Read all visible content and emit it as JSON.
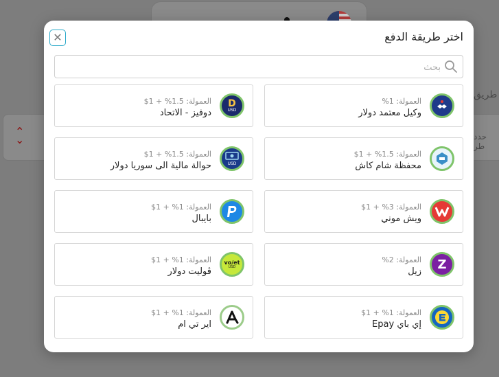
{
  "modal": {
    "title": "اختر طريقة الدفع",
    "close_label": "✕",
    "search_placeholder": "بحث"
  },
  "background": {
    "side_text_1": "طريق",
    "side_text_2": "حدد طر"
  },
  "fee_prefix": "العمولة:",
  "methods": [
    {
      "name": "وكيل معتمد دولار",
      "fee": "العمولة: 1%",
      "icon": "handshake-icon"
    },
    {
      "name": "دوفيز - الاتحاد",
      "fee": "العمولة: 1.5% + 1$",
      "icon": "dovise-icon"
    },
    {
      "name": "محفظة شام كاش",
      "fee": "العمولة: 1.5% + 1$",
      "icon": "sham-cash-icon"
    },
    {
      "name": "حوالة مالية الى سوريا دولار",
      "fee": "العمولة: 1.5% + 1$",
      "icon": "money-transfer-icon"
    },
    {
      "name": "ويش موني",
      "fee": "العمولة: 3% + 1$",
      "icon": "wish-money-icon"
    },
    {
      "name": "بايبال",
      "fee": "العمولة: 1% + 1$",
      "icon": "paypal-icon"
    },
    {
      "name": "زيل",
      "fee": "العمولة: 2%",
      "icon": "zelle-icon"
    },
    {
      "name": "ڤوليت دولار",
      "fee": "العمولة: 1% + 1$",
      "icon": "volet-icon"
    },
    {
      "name": "إي باي Epay",
      "fee": "العمولة: 1% + 1$",
      "icon": "epay-icon"
    },
    {
      "name": "اير تي ام",
      "fee": "العمولة: 1% + 1$",
      "icon": "airtm-icon"
    }
  ],
  "logos": {
    "dovise": "D",
    "usd": "USD",
    "volet": "vo/et",
    "zelle": "Z"
  }
}
